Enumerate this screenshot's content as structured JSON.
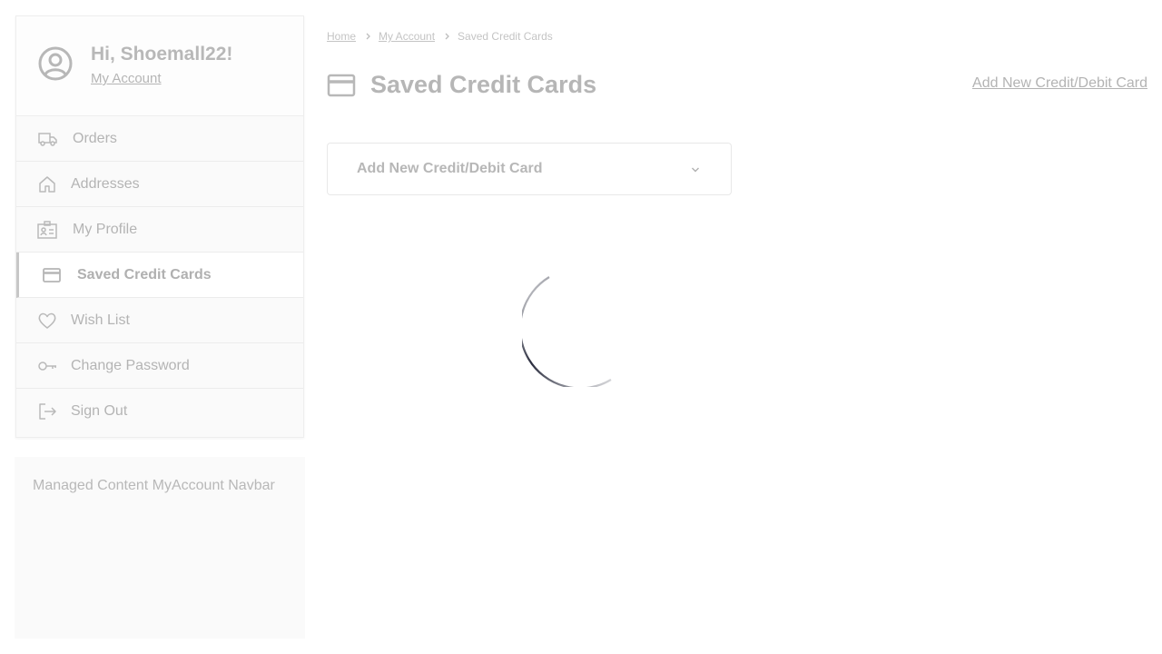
{
  "sidebar": {
    "greeting": "Hi, Shoemall22!",
    "my_account_link": "My Account",
    "items": [
      {
        "label": "Orders",
        "icon": "truck-icon"
      },
      {
        "label": "Addresses",
        "icon": "home-icon"
      },
      {
        "label": "My Profile",
        "icon": "id-card-icon"
      },
      {
        "label": "Saved Credit Cards",
        "icon": "credit-card-icon",
        "active": true
      },
      {
        "label": "Wish List",
        "icon": "heart-icon"
      },
      {
        "label": "Change Password",
        "icon": "key-icon"
      },
      {
        "label": "Sign Out",
        "icon": "sign-out-icon"
      }
    ]
  },
  "managed_content": "Managed Content MyAccount Navbar",
  "breadcrumb": {
    "home": "Home",
    "my_account": "My Account",
    "current": "Saved Credit Cards"
  },
  "page": {
    "title": "Saved Credit Cards",
    "add_link": "Add New Credit/Debit Card",
    "accordion_label": "Add New Credit/Debit Card"
  },
  "colors": {
    "spinner": "#2a2d3e",
    "muted_text": "#b6b6b6"
  }
}
